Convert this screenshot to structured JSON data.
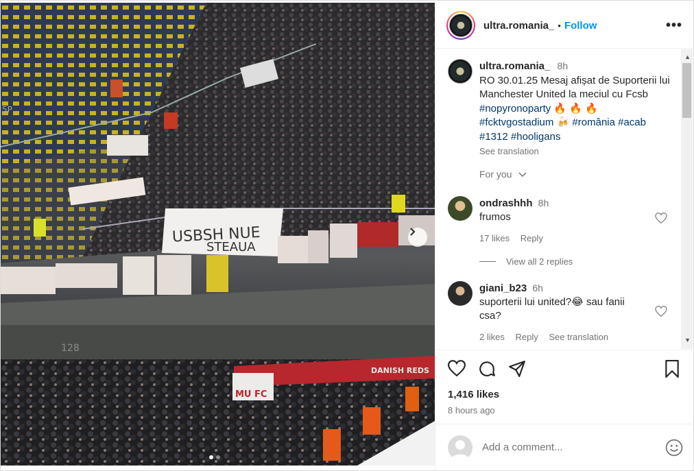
{
  "post": {
    "username": "ultra.romania_",
    "separator": "•",
    "follow_label": "Follow",
    "more_label": "•••"
  },
  "caption": {
    "username": "ultra.romania_",
    "time": "8h",
    "text": "RO 30.01.25 Mesaj afișat de Suporterii lui Manchester United la meciul cu Fcsb",
    "hashtags_line1": "#nopyronoparty",
    "flames": "🔥 🔥 🔥",
    "hashtags_line2a": "#fcktvgostadium",
    "beer": "🍻",
    "hashtags_line2b": "#românia #acab",
    "hashtags_line3": "#1312 #hooligans",
    "see_translation": "See translation"
  },
  "for_you": "For you",
  "comments": [
    {
      "username": "ondrashhh",
      "time": "8h",
      "text": "frumos",
      "likes": "17 likes",
      "reply": "Reply",
      "avatar_color": "#3d4a2a"
    },
    {
      "username": "giani_b23",
      "time": "6h",
      "text": "suporterii lui united?😂 sau fanii csa?",
      "likes": "2 likes",
      "reply": "Reply",
      "translate": "See translation",
      "avatar_color": "#2a2a2a"
    }
  ],
  "view_replies": "View all 2 replies",
  "actions": {
    "likes": "1,416 likes",
    "ago": "8 hours ago"
  },
  "add_comment": {
    "placeholder": "Add a comment..."
  },
  "photo_banners": {
    "big_banner": "USBSH NUE STEAUA",
    "lower_banner_left": "MU FC",
    "lower_banner_right": "DANISH REDS",
    "section_number": "128",
    "section_b": "5P"
  }
}
